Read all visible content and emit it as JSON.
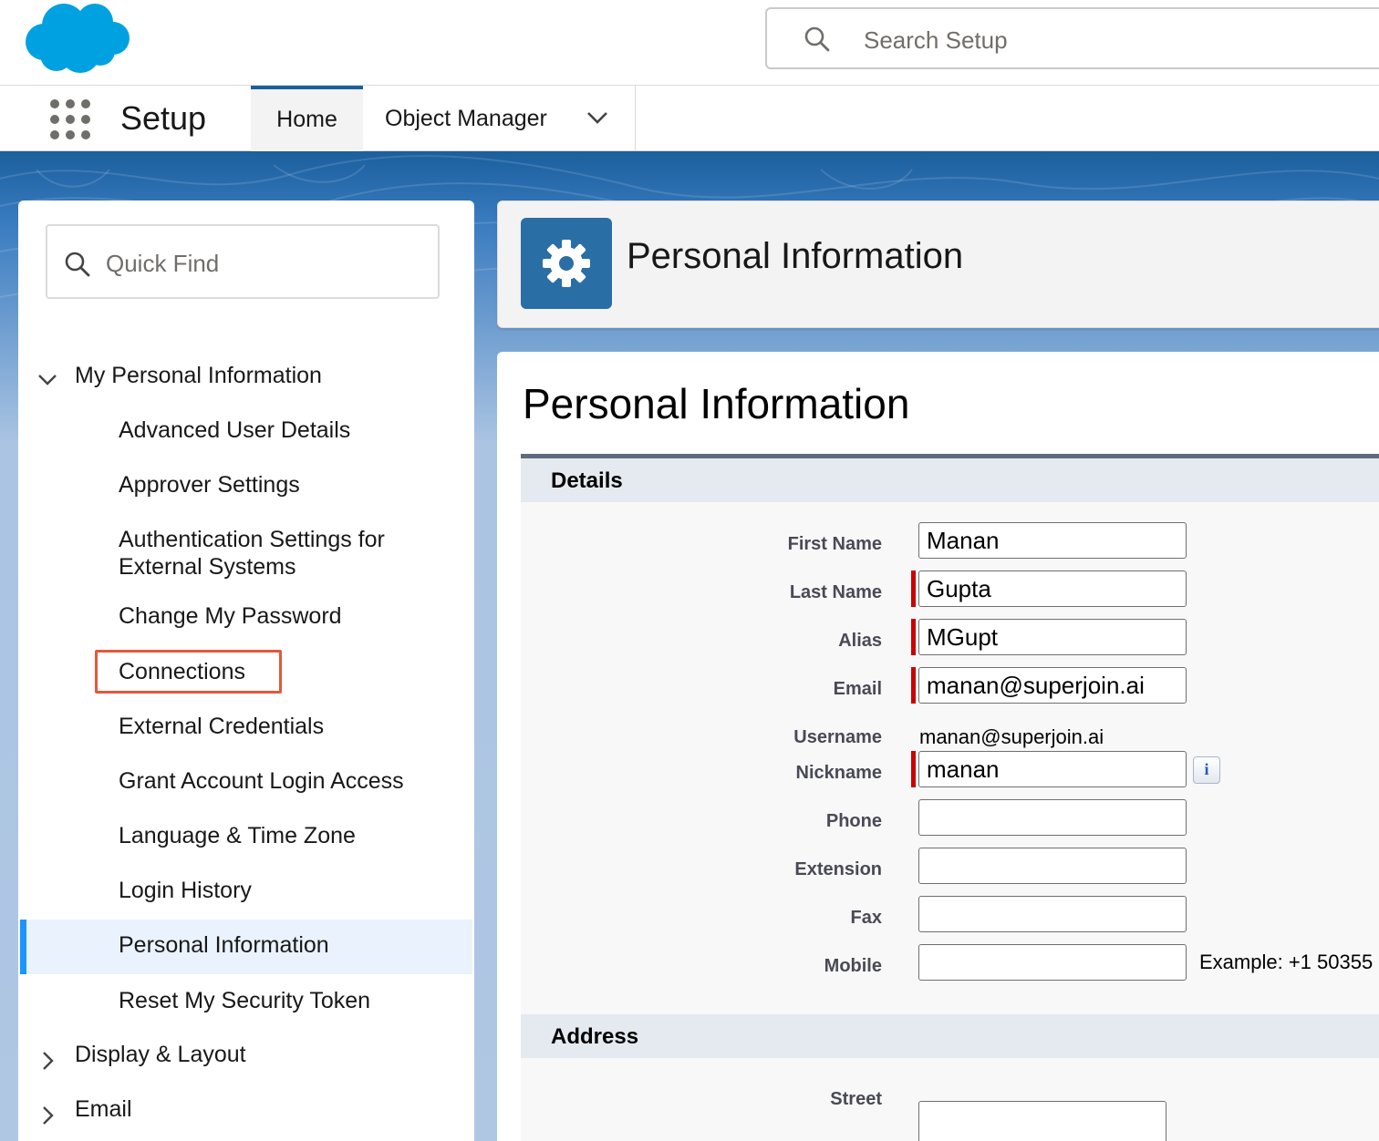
{
  "header": {
    "search_placeholder": "Search Setup"
  },
  "nav": {
    "app_name": "Setup",
    "tabs": [
      {
        "label": "Home"
      },
      {
        "label": "Object Manager"
      }
    ]
  },
  "sidebar": {
    "quick_find_placeholder": "Quick Find",
    "section_open": "My Personal Information",
    "items": [
      "Advanced User Details",
      "Approver Settings",
      "Authentication Settings for",
      "External Systems",
      "Change My Password",
      "Connections",
      "External Credentials",
      "Grant Account Login Access",
      "Language & Time Zone",
      "Login History",
      "Personal Information",
      "Reset My Security Token"
    ],
    "sections_collapsed": [
      "Display & Layout",
      "Email"
    ]
  },
  "page_header": {
    "title": "Personal Information"
  },
  "content": {
    "title": "Personal Information",
    "details_heading": "Details",
    "address_heading": "Address",
    "fields": {
      "first_name": {
        "label": "First Name",
        "value": "Manan"
      },
      "last_name": {
        "label": "Last Name",
        "value": "Gupta"
      },
      "alias": {
        "label": "Alias",
        "value": "MGupt"
      },
      "email": {
        "label": "Email",
        "value": "manan@superjoin.ai"
      },
      "username": {
        "label": "Username",
        "value": "manan@superjoin.ai"
      },
      "nickname": {
        "label": "Nickname",
        "value": "manan"
      },
      "phone": {
        "label": "Phone",
        "value": ""
      },
      "extension": {
        "label": "Extension",
        "value": ""
      },
      "fax": {
        "label": "Fax",
        "value": ""
      },
      "mobile": {
        "label": "Mobile",
        "value": ""
      },
      "street": {
        "label": "Street",
        "value": ""
      }
    },
    "mobile_hint": "Example: +1 50355",
    "info_icon_glyph": "i"
  },
  "colors": {
    "brand_blue": "#00a1e0",
    "accent_blue": "#1b96ff",
    "required_red": "#cc0000",
    "highlight_orange": "#e5573b",
    "gear_tile": "#2a6ea6"
  }
}
